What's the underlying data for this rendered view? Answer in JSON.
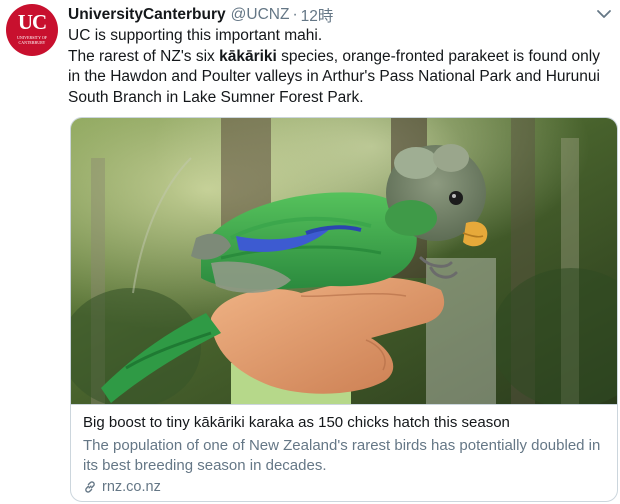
{
  "account": {
    "avatar_logo": "UC",
    "avatar_subtext": "UNIVERSITY OF CANTERBURY",
    "display_name": "UniversityCanterbury",
    "handle": "@UCNZ",
    "separator": "·",
    "time": "12時"
  },
  "tweet": {
    "line1": "UC is supporting this important mahi.",
    "body_prefix": "The rarest of NZ's six ",
    "body_bold": "kākāriki",
    "body_suffix": " species, orange-fronted parakeet is found only in the Hawdon and Poulter valleys in Arthur's Pass National Park and Hurunui South Branch in Lake Sumner Forest Park."
  },
  "card": {
    "title": "Big boost to tiny kākāriki karaka as 150 chicks hatch this season",
    "description": "The population of one of New Zealand's rarest birds has potentially doubled in its best breeding season in decades.",
    "domain": "rnz.co.nz"
  },
  "colors": {
    "brand_red": "#c8102e",
    "text_primary": "#14171a",
    "text_secondary": "#657786",
    "border": "#ccd6dd"
  },
  "icons": [
    "chevron-down-icon",
    "link-icon"
  ]
}
